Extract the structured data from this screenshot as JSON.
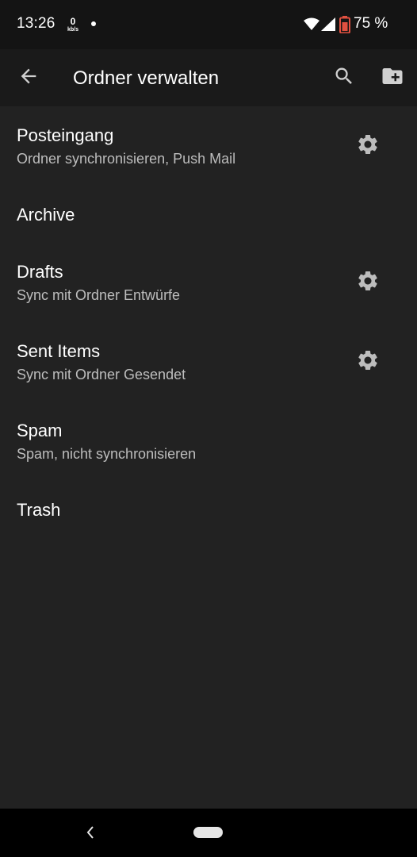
{
  "status_bar": {
    "time": "13:26",
    "speed_value": "0",
    "speed_unit": "kb/s",
    "battery": "75 %",
    "battery_accent": "#e05040"
  },
  "app_bar": {
    "title": "Ordner verwalten",
    "back_icon": "arrow-back-icon",
    "search_icon": "search-icon",
    "add_folder_icon": "create-folder-icon"
  },
  "folders": [
    {
      "name": "Posteingang",
      "subtitle": "Ordner synchronisieren, Push Mail",
      "has_settings": true
    },
    {
      "name": "Archive",
      "subtitle": "",
      "has_settings": false
    },
    {
      "name": "Drafts",
      "subtitle": "Sync mit Ordner Entwürfe",
      "has_settings": true
    },
    {
      "name": "Sent Items",
      "subtitle": "Sync mit Ordner Gesendet",
      "has_settings": true
    },
    {
      "name": "Spam",
      "subtitle": "Spam, nicht synchronisieren",
      "has_settings": false
    },
    {
      "name": "Trash",
      "subtitle": "",
      "has_settings": false
    }
  ],
  "colors": {
    "background": "#222222",
    "app_bar": "#1a1a1a",
    "status_bar": "#141414",
    "secondary_text": "#bdbdbd",
    "icon": "#bdbdbd"
  }
}
